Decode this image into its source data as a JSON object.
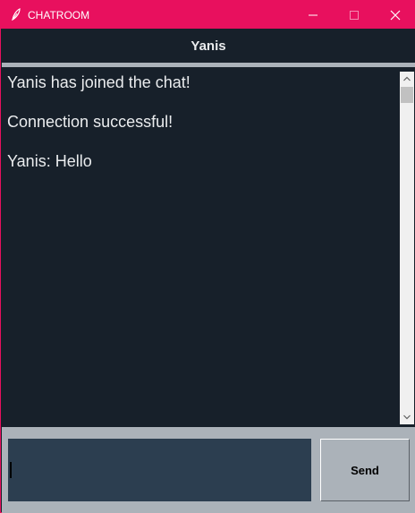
{
  "window": {
    "title": "CHATROOM",
    "accent_color": "#e8105e",
    "app_icon": "feather-icon",
    "controls": [
      "minimize-icon",
      "maximize-icon",
      "close-icon"
    ]
  },
  "header": {
    "username": "Yanis",
    "background": "#17202a",
    "text_color": "#eaecee"
  },
  "chat": {
    "messages": [
      "Yanis has joined the chat!",
      "Connection successful!",
      "Yanis: Hello"
    ]
  },
  "composer": {
    "input_value": "",
    "send_label": "Send",
    "input_background": "#2c3e50",
    "panel_background": "#abb2b9"
  }
}
